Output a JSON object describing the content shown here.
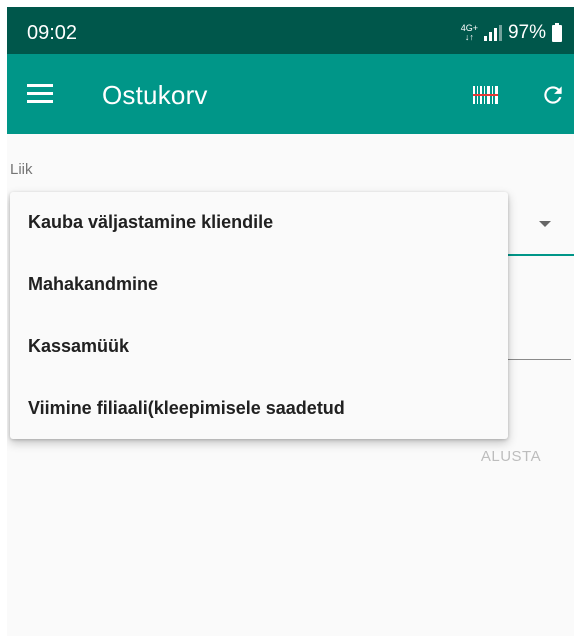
{
  "status_bar": {
    "time": "09:02",
    "network_type_top": "4G+",
    "network_type_bottom": "↓↑",
    "battery": "97%"
  },
  "app_bar": {
    "title": "Ostukorv",
    "menu_icon": "hamburger-menu-icon",
    "barcode_icon": "barcode-scanner-icon",
    "refresh_icon": "refresh-icon",
    "color": "#009688"
  },
  "form": {
    "type_label": "Liik",
    "start_button": "ALUSTA"
  },
  "dropdown": {
    "options": [
      "Kauba väljastamine kliendile",
      "Mahakandmine",
      "Kassamüük",
      "Viimine filiaali(kleepimisele saadetud"
    ]
  },
  "colors": {
    "status_bar": "#00574b",
    "accent": "#009688"
  }
}
